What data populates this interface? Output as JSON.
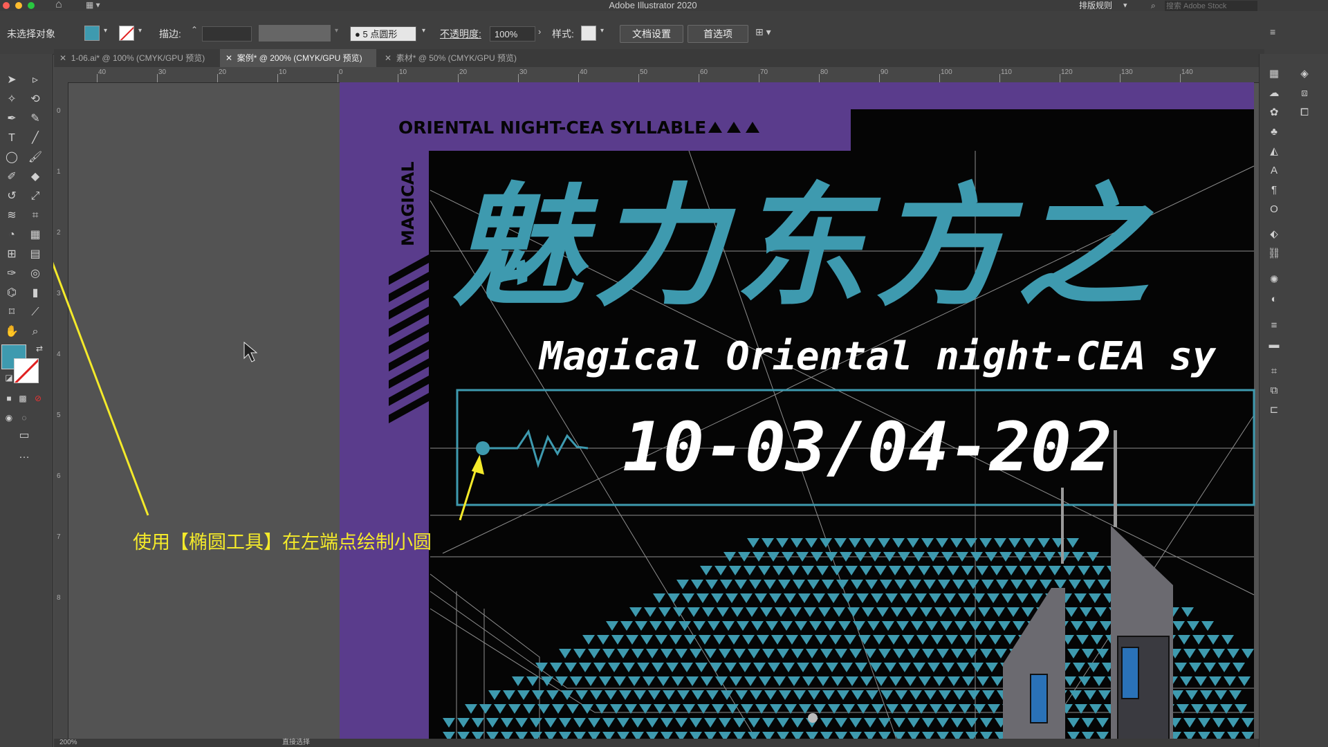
{
  "app": {
    "title": "Adobe Illustrator 2020",
    "workspace_label": "排版规则",
    "stock_search_placeholder": "搜索 Adobe Stock"
  },
  "controlbar": {
    "selection_status": "未选择对象",
    "stroke_label": "描边:",
    "brush_label": "5 点圆形",
    "opacity_label": "不透明度:",
    "opacity_value": "100%",
    "style_label": "样式:",
    "doc_setup_button": "文档设置",
    "preferences_button": "首选项"
  },
  "tabs": [
    {
      "label": "1-06.ai* @ 100% (CMYK/GPU 预览)",
      "active": false
    },
    {
      "label": "案例* @ 200% (CMYK/GPU 预览)",
      "active": true
    },
    {
      "label": "素材* @ 50% (CMYK/GPU 预览)",
      "active": false
    }
  ],
  "rulers": {
    "horizontal": [
      "40",
      "30",
      "20",
      "10",
      "0",
      "10",
      "20",
      "30",
      "40",
      "50",
      "60",
      "70",
      "80",
      "90",
      "100",
      "110",
      "120",
      "130",
      "140"
    ],
    "vertical": [
      "0",
      "1",
      "2",
      "3",
      "4",
      "5",
      "6",
      "7",
      "8"
    ]
  },
  "artwork": {
    "header_text": "ORIENTAL NIGHT-CEA SYLLABLE",
    "side_text": "MAGICAL",
    "title_cn": "魅力东方之",
    "subtitle_en": "Magical Oriental night-CEA sy",
    "date_text": "10-03/04-202"
  },
  "annotation": {
    "text": "使用【椭圆工具】在左端点绘制小圆"
  },
  "statusbar": {
    "zoom": "200%",
    "tool_name": "直接选择"
  },
  "colors": {
    "teal": "#3e9aaf",
    "purple": "#5a3c8c",
    "annotation_yellow": "#f4ea2a",
    "ui_dark": "#3f3f3f"
  }
}
